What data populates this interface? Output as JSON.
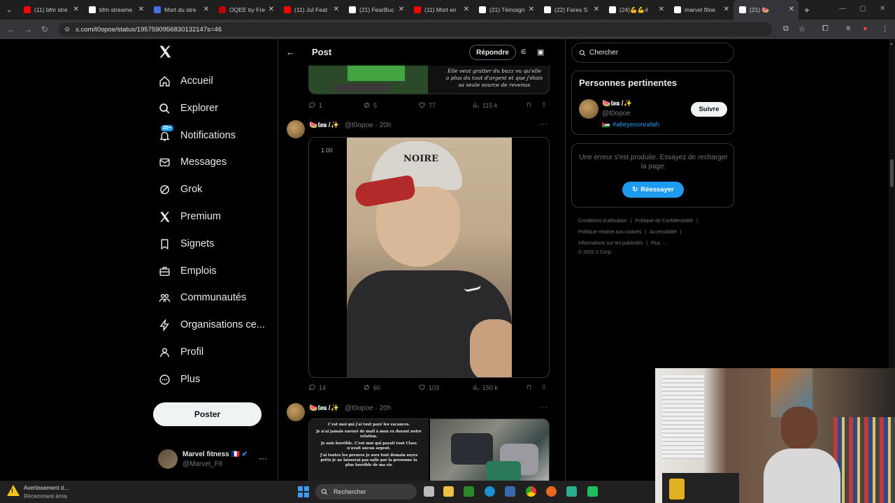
{
  "browser": {
    "tabs": [
      {
        "label": "(11) bfm stre",
        "icon": "youtube-icon",
        "color": "#ff0000"
      },
      {
        "label": "bfm streame",
        "icon": "google-icon",
        "color": "#ffffff"
      },
      {
        "label": "Mort du stre",
        "icon": "wiki-icon",
        "color": "#4a6ee0"
      },
      {
        "label": "OQEE by Fre",
        "icon": "oqee-icon",
        "color": "#c00000"
      },
      {
        "label": "(11) Jul Feat",
        "icon": "youtube-icon",
        "color": "#ff0000"
      },
      {
        "label": "(21) FearBuc",
        "icon": "x-icon",
        "color": "#ffffff"
      },
      {
        "label": "(11) Mort en",
        "icon": "youtube-icon",
        "color": "#ff0000"
      },
      {
        "label": "(21) Témoign",
        "icon": "x-icon",
        "color": "#ffffff"
      },
      {
        "label": "(22) Fares S",
        "icon": "x-icon",
        "color": "#ffffff"
      },
      {
        "label": "(24)💪💪#",
        "icon": "tiktok-icon",
        "color": "#ffffff"
      },
      {
        "label": "marvel fitne",
        "icon": "tiktok-icon",
        "color": "#ffffff"
      },
      {
        "label": "(21) 🍉",
        "icon": "x-icon",
        "color": "#ffffff"
      }
    ],
    "url": "x.com/t0opoe/status/1957590956830132147s=46"
  },
  "nav": {
    "items": [
      {
        "label": "Accueil",
        "icon": "home-icon"
      },
      {
        "label": "Explorer",
        "icon": "search-icon"
      },
      {
        "label": "Notifications",
        "icon": "bell-icon",
        "badge": "20+"
      },
      {
        "label": "Messages",
        "icon": "mail-icon"
      },
      {
        "label": "Grok",
        "icon": "grok-icon"
      },
      {
        "label": "Premium",
        "icon": "x-icon"
      },
      {
        "label": "Signets",
        "icon": "bookmark-icon"
      },
      {
        "label": "Emplois",
        "icon": "briefcase-icon"
      },
      {
        "label": "Communautés",
        "icon": "people-icon"
      },
      {
        "label": "Organisations ce...",
        "icon": "bolt-icon"
      },
      {
        "label": "Profil",
        "icon": "person-icon"
      },
      {
        "label": "Plus",
        "icon": "more-circle-icon"
      }
    ],
    "post_button": "Poster",
    "account": {
      "name": "Marvel fitness 🇫🇷",
      "handle": "@Marvel_Fit"
    }
  },
  "header": {
    "title": "Post",
    "reply_button": "Répondre"
  },
  "posts": [
    {
      "quote_text": "Elle veut gratter du buzz vu qu'elle a plus du tout d'argent et que j'étais sa seule source de revenus",
      "replies": "1",
      "reposts": "5",
      "likes": "77",
      "views": "115 k"
    },
    {
      "author": "🍉𝖑𝖔𝖚 /✨",
      "handle_time": "@t0opoe · 20h",
      "video_speed": "1.00",
      "cap_text": "NOIRE",
      "replies": "14",
      "reposts": "60",
      "likes": "103",
      "views": "150 k"
    },
    {
      "author": "🍉𝖑𝖔𝖚 /✨",
      "handle_time": "@t0opoe · 20h",
      "image_text": [
        "C'est moi qui j'ai tout payé les vacances.",
        "Je n'ai jamais envoyé de mail à mon ex durant notre relation.",
        "Je suis horrible. C'est moi qui payait tout Clara n'avait aucun argent.",
        "J'ai toutes les preuves je sors tout demain soyez prêts je ne laisserai pas salir par la personne la plus horrible de ma vie"
      ]
    }
  ],
  "right": {
    "search_placeholder": "Chercher",
    "relevant_title": "Personnes pertinentes",
    "person": {
      "name": "🍉𝖑𝖔𝖚 /✨",
      "handle": "@t0opoe",
      "bio": "#alleyesonrafah"
    },
    "follow_button": "Suivre",
    "error_message": "Une erreur s'est produite. Essayez de recharger la page.",
    "retry_button": "Réessayer",
    "footer": {
      "terms": "Conditions d'utilisation",
      "privacy": "Politique de Confidentialité",
      "cookies": "Politique relative aux cookies",
      "accessibility": "Accessibilité",
      "ads": "Informations sur les publicités",
      "more": "Plus ···",
      "copyright": "© 2025 X Corp."
    }
  },
  "taskbar": {
    "notification_title": "Avertissement d...",
    "notification_sub": "Récemment émis",
    "search": "Rechercher"
  },
  "colors": {
    "accent": "#1d9bf0",
    "background": "#000000",
    "border": "#2f3336",
    "muted": "#71767b"
  }
}
